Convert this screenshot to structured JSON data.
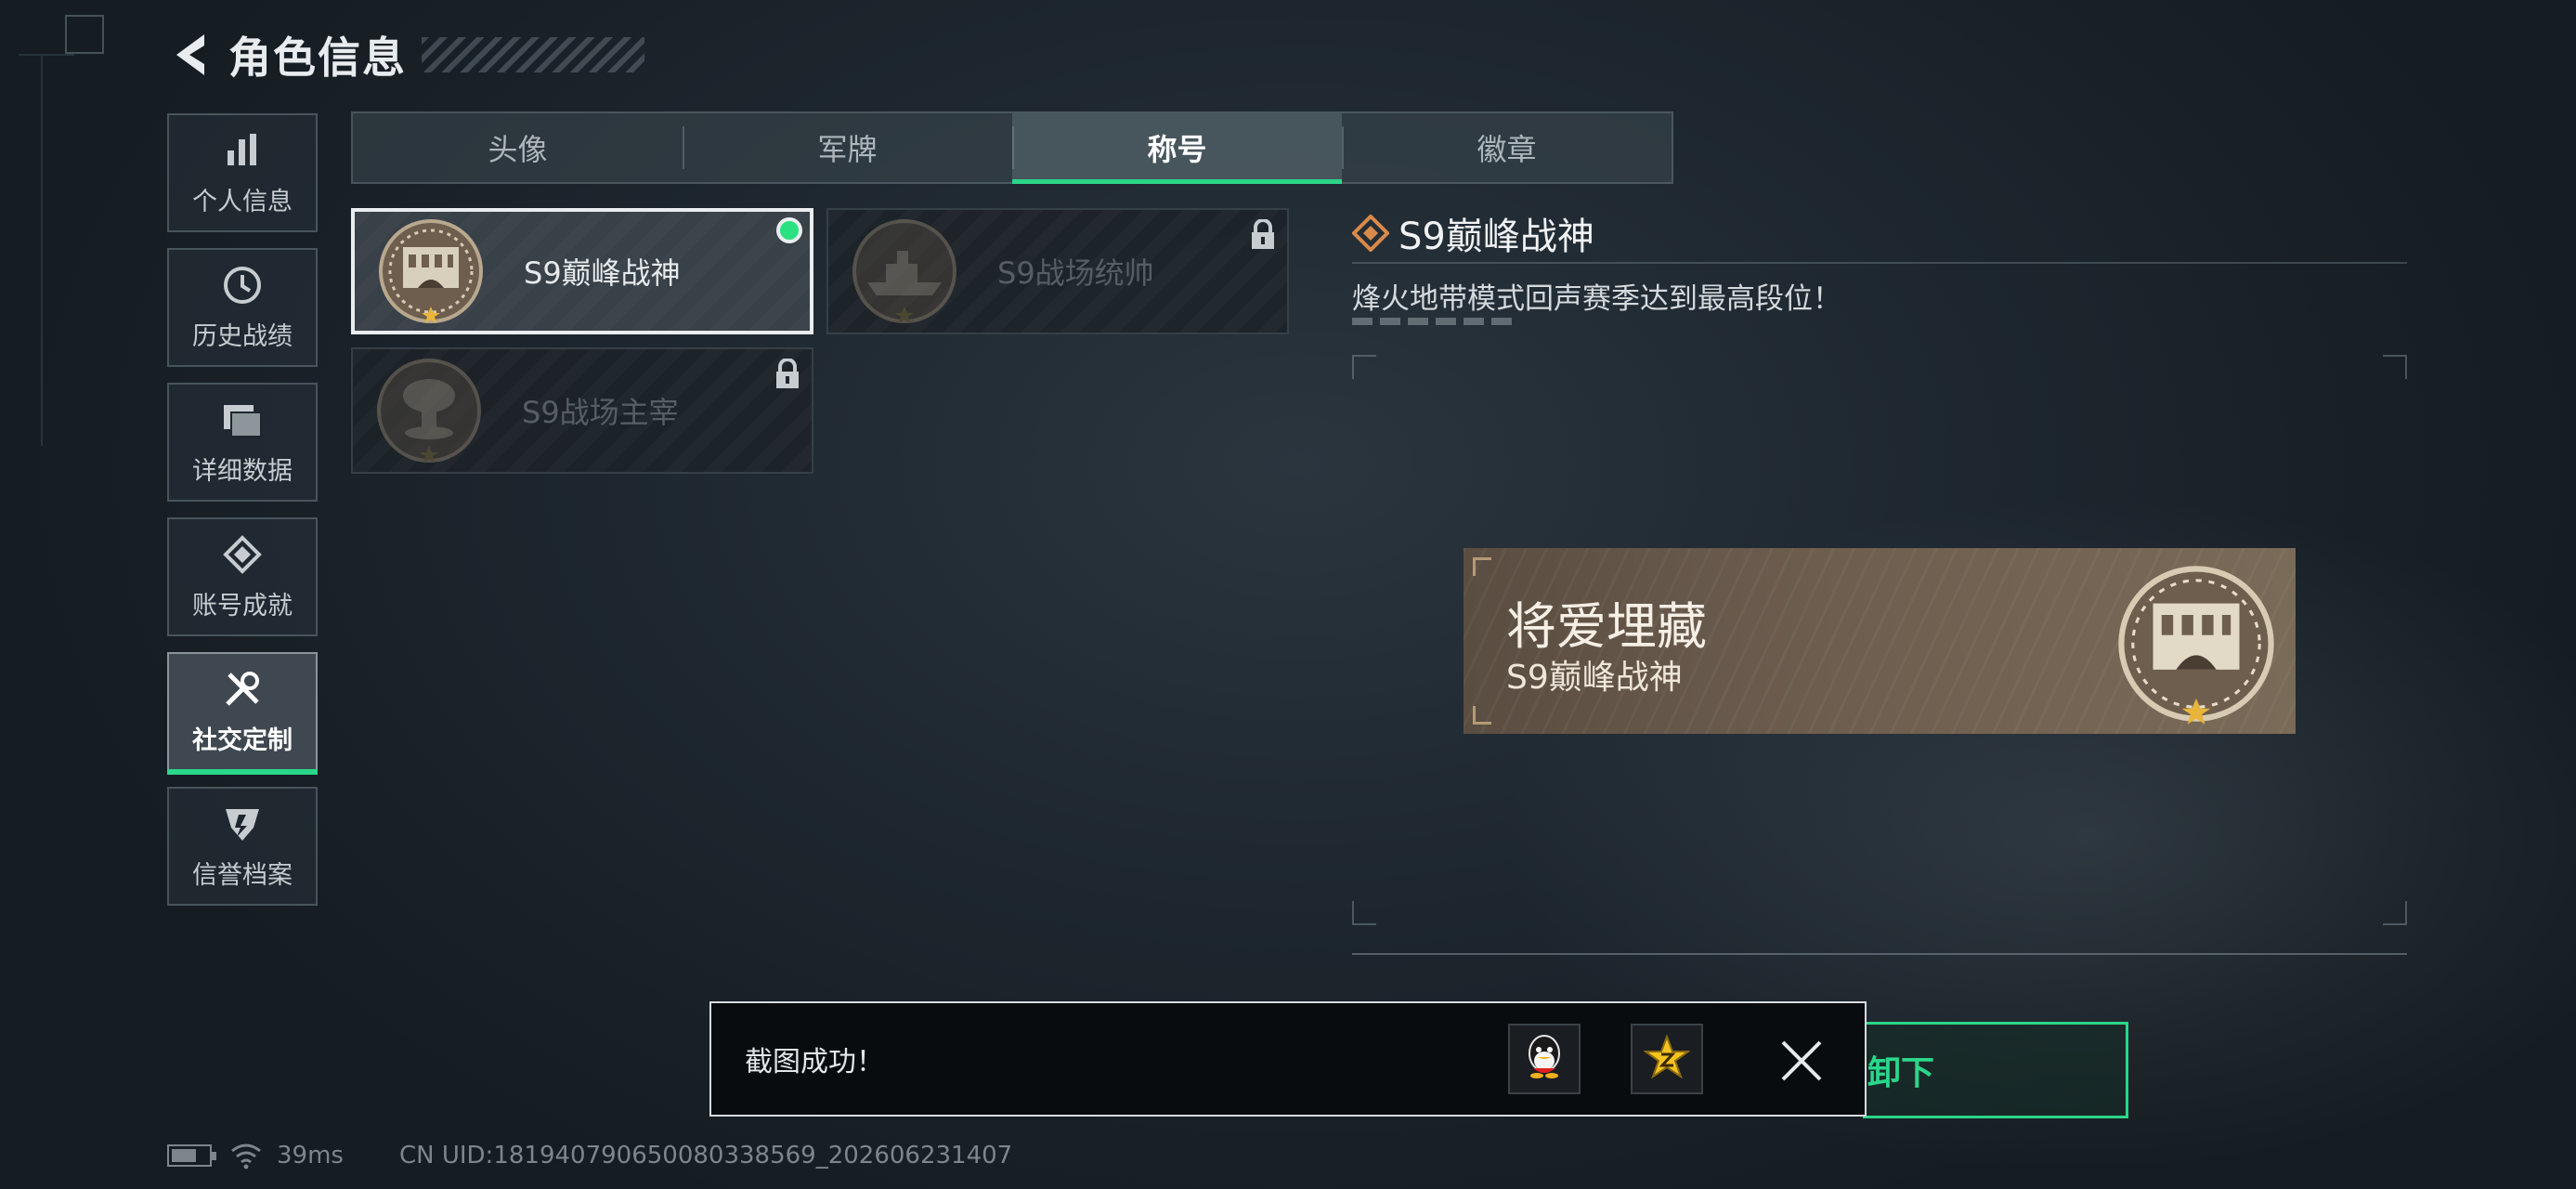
{
  "header": {
    "title": "角色信息"
  },
  "sidebar": {
    "items": [
      {
        "label": "个人信息",
        "icon": "bar-chart-icon"
      },
      {
        "label": "历史战绩",
        "icon": "clock-history-icon"
      },
      {
        "label": "详细数据",
        "icon": "folders-icon"
      },
      {
        "label": "账号成就",
        "icon": "achievement-icon"
      },
      {
        "label": "社交定制",
        "icon": "tools-icon",
        "active": true
      },
      {
        "label": "信誉档案",
        "icon": "reputation-icon"
      }
    ]
  },
  "tabs": [
    {
      "label": "头像"
    },
    {
      "label": "军牌"
    },
    {
      "label": "称号",
      "active": true
    },
    {
      "label": "徽章"
    }
  ],
  "titles": [
    {
      "label": "S9巅峰战神",
      "state": "equipped",
      "emblem": "fortress-emblem-icon"
    },
    {
      "label": "S9战场统帅",
      "state": "locked",
      "emblem": "warship-emblem-icon"
    },
    {
      "label": "S9战场主宰",
      "state": "locked",
      "emblem": "mushroom-cloud-emblem-icon"
    }
  ],
  "detail": {
    "title": "S9巅峰战神",
    "description": "烽火地带模式回声赛季达到最高段位！"
  },
  "nameplate": {
    "player_name": "将爱埋藏",
    "title": "S9巅峰战神"
  },
  "toast": {
    "message": "截图成功！",
    "share_targets": [
      "qq-icon",
      "qzone-icon"
    ]
  },
  "unequip_button": {
    "label": "卸下"
  },
  "status_bar": {
    "ping": "39ms",
    "uid": "CN UID:18194079065008033856​9_202606231407"
  },
  "colors": {
    "accent": "#2bd68a",
    "equipped_dot": "#2be07f",
    "background": "#1d262e",
    "nameplate": "#6d5e4f"
  }
}
